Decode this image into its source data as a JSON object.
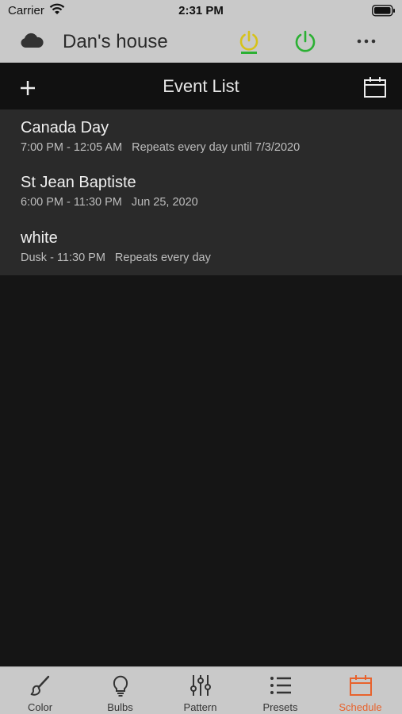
{
  "status_bar": {
    "carrier": "Carrier",
    "time": "2:31 PM"
  },
  "header": {
    "title": "Dan's house",
    "icons": [
      "cloud-icon",
      "timer-power-icon",
      "power-icon",
      "more-icon"
    ],
    "colors": {
      "timer": "#d6c21a",
      "power": "#2bb033"
    }
  },
  "toolbar": {
    "title": "Event List",
    "add_icon": "plus-icon",
    "calendar_icon": "calendar-icon"
  },
  "events": [
    {
      "name": "Canada Day",
      "time": "7:00 PM - 12:05 AM",
      "info": "Repeats every day until 7/3/2020"
    },
    {
      "name": "St Jean Baptiste",
      "time": "6:00 PM - 11:30 PM",
      "info": "Jun 25, 2020"
    },
    {
      "name": "white",
      "time": "Dusk - 11:30 PM",
      "info": "Repeats every day"
    }
  ],
  "tabs": [
    {
      "label": "Color",
      "icon": "brush-icon"
    },
    {
      "label": "Bulbs",
      "icon": "bulb-icon"
    },
    {
      "label": "Pattern",
      "icon": "sliders-icon"
    },
    {
      "label": "Presets",
      "icon": "list-icon"
    },
    {
      "label": "Schedule",
      "icon": "calendar-icon",
      "active": true
    }
  ],
  "accent_color": "#e8622c"
}
